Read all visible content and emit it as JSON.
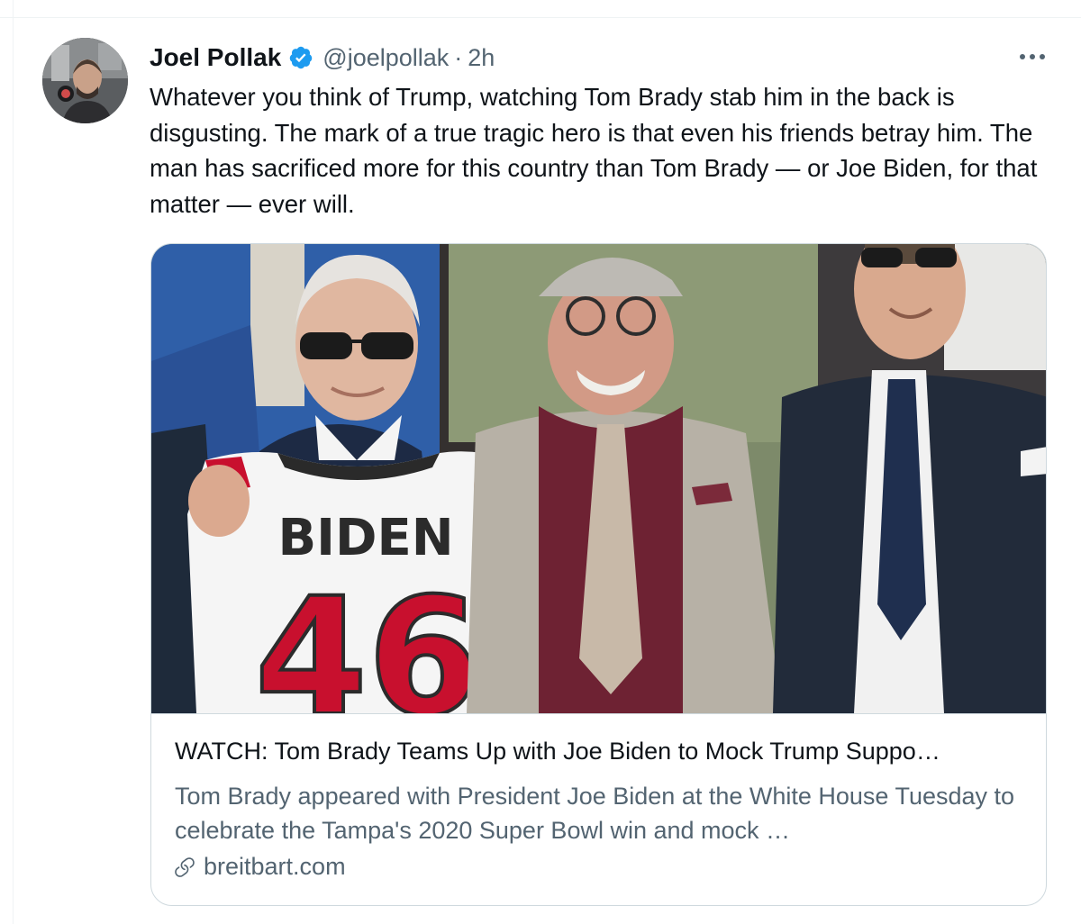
{
  "tweet": {
    "display_name": "Joel Pollak",
    "handle": "@joelpollak",
    "separator": "·",
    "time": "2h",
    "verified": true,
    "text": "Whatever you think of Trump, watching Tom Brady stab him in the back is disgusting. The mark of a true tragic hero is that even his friends betray him. The man has sacrificed more for this country than Tom Brady — or Joe Biden, for that matter — ever will."
  },
  "card": {
    "title": "WATCH: Tom Brady Teams Up with Joe Biden to Mock Trump Suppo…",
    "description": "Tom Brady appeared with President Joe Biden at the White House Tuesday to celebrate the Tampa's 2020 Super Bowl win and mock …",
    "domain": "breitbart.com",
    "image": {
      "jersey_name": "BIDEN",
      "jersey_number": "46"
    }
  },
  "colors": {
    "text_primary": "#0f1419",
    "text_secondary": "#536471",
    "verified_blue": "#1d9bf0",
    "border": "#cfd9de",
    "jersey_red": "#c8102e"
  },
  "icons": {
    "verified": "verified-badge-icon",
    "more": "more-options-icon",
    "link": "link-icon"
  }
}
